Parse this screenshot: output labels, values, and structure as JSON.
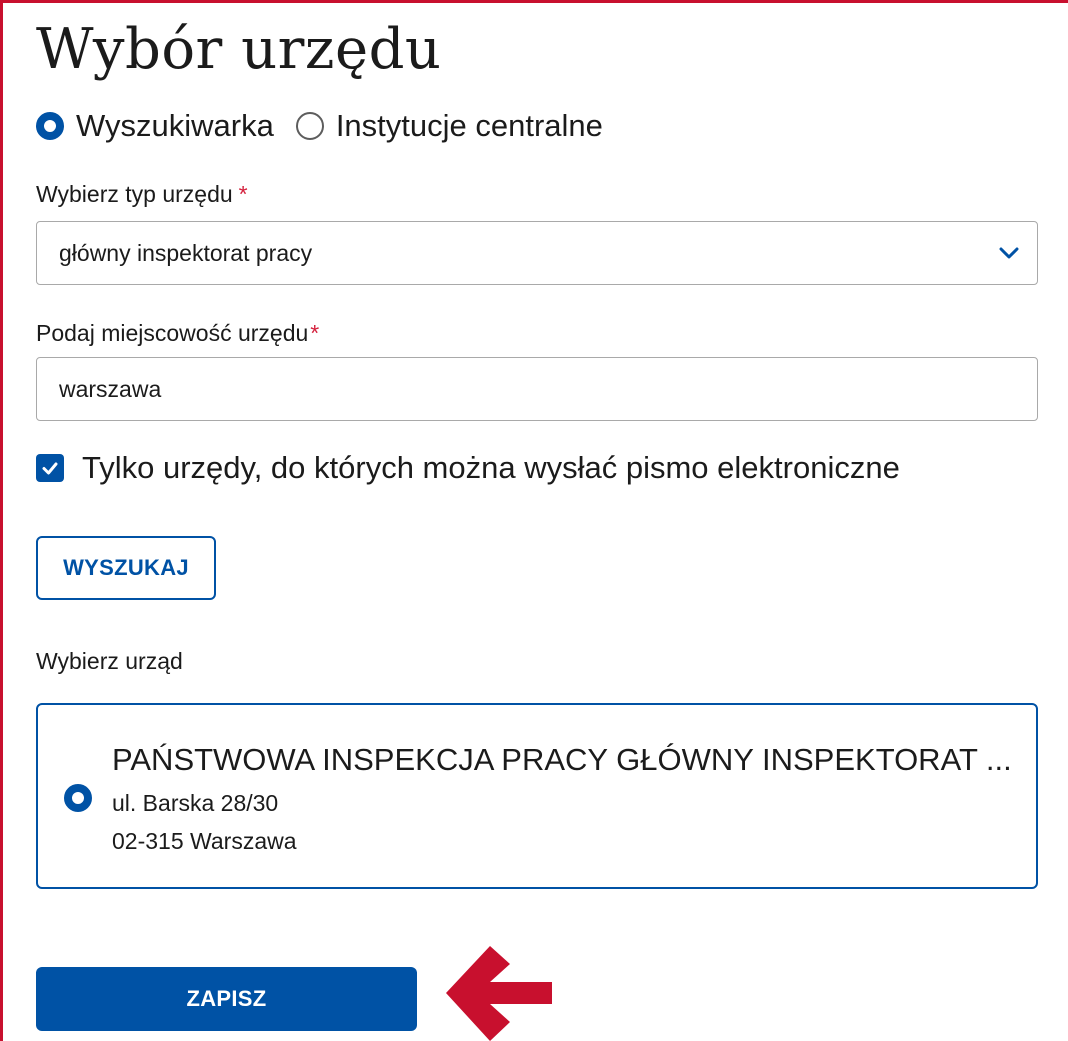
{
  "page": {
    "title": "Wybór urzędu"
  },
  "mode": {
    "options": [
      {
        "label": "Wyszukiwarka",
        "selected": true
      },
      {
        "label": "Instytucje centralne",
        "selected": false
      }
    ]
  },
  "office_type": {
    "label": "Wybierz typ urzędu",
    "required_mark": "*",
    "value": "główny inspektorat pracy",
    "icon": "chevron-down-icon"
  },
  "city": {
    "label": "Podaj miejscowość urzędu",
    "required_mark": "*",
    "value": "warszawa"
  },
  "electronic_only": {
    "label": "Tylko urzędy, do których można wysłać pismo elektroniczne",
    "checked": true
  },
  "search_button": {
    "label": "WYSZUKAJ"
  },
  "results": {
    "label": "Wybierz urząd",
    "items": [
      {
        "name": "PAŃSTWOWA INSPEKCJA PRACY GŁÓWNY INSPEKTORAT ...",
        "street": "ul. Barska 28/30",
        "city": "02-315 Warszawa",
        "selected": true
      }
    ]
  },
  "save_button": {
    "label": "ZAPISZ"
  },
  "colors": {
    "accent": "#0052a5",
    "frame": "#c8102e",
    "required": "#d4213d",
    "annotation_arrow": "#c8102e"
  }
}
